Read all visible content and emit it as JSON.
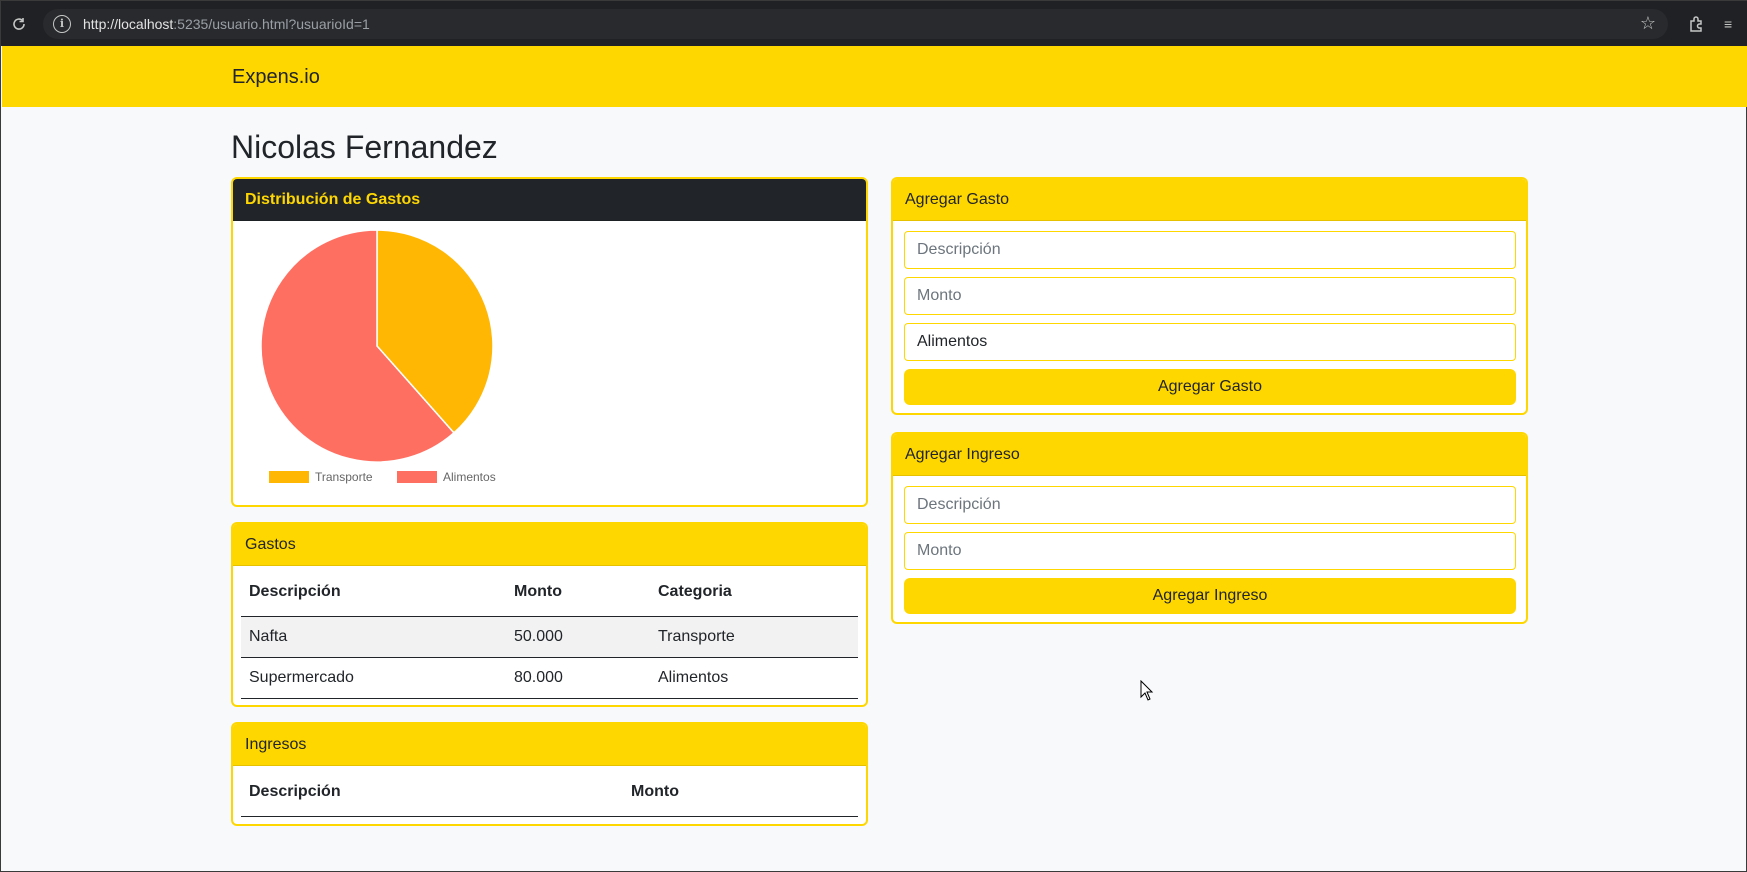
{
  "browser": {
    "url_host": "http://localhost",
    "url_rest": ":5235/usuario.html?usuarioId=1"
  },
  "navbar": {
    "brand": "Expens.io"
  },
  "user": {
    "name": "Nicolas Fernandez"
  },
  "chart_card": {
    "title": "Distribución de Gastos"
  },
  "chart_data": {
    "type": "pie",
    "categories": [
      "Transporte",
      "Alimentos"
    ],
    "values": [
      50000,
      80000
    ],
    "colors": [
      "#ffb703",
      "#ff6f61"
    ],
    "legend": "bottom"
  },
  "gastos": {
    "title": "Gastos",
    "columns": [
      "Descripción",
      "Monto",
      "Categoria"
    ],
    "rows": [
      [
        "Nafta",
        "50.000",
        "Transporte"
      ],
      [
        "Supermercado",
        "80.000",
        "Alimentos"
      ]
    ]
  },
  "ingresos": {
    "title": "Ingresos",
    "columns": [
      "Descripción",
      "Monto"
    ]
  },
  "form_gasto": {
    "title": "Agregar Gasto",
    "descripcion_placeholder": "Descripción",
    "monto_placeholder": "Monto",
    "categoria_selected": "Alimentos",
    "submit_label": "Agregar Gasto"
  },
  "form_ingreso": {
    "title": "Agregar Ingreso",
    "descripcion_placeholder": "Descripción",
    "monto_placeholder": "Monto",
    "submit_label": "Agregar Ingreso"
  },
  "colors": {
    "primary": "#ffd700",
    "dark": "#212529"
  }
}
